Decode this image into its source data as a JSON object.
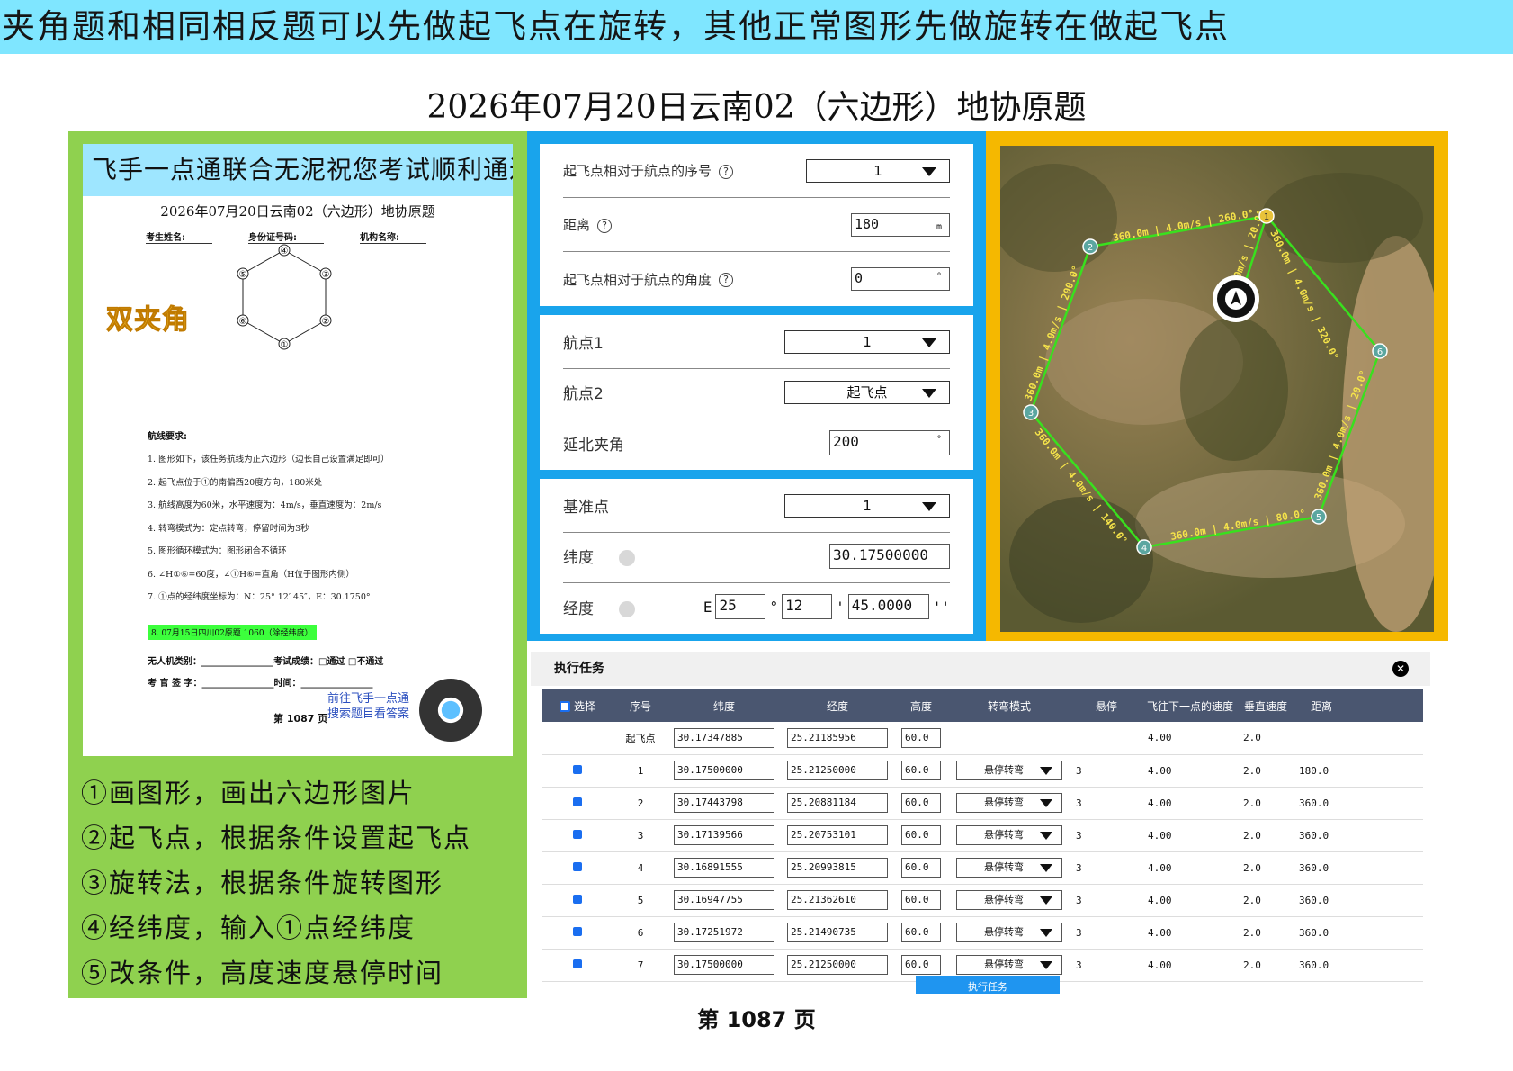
{
  "banner": "夹角题和相同相反题可以先做起飞点在旋转，其他正常图形先做旋转在做起飞点",
  "page_title": "2026年07月20日云南02（六边形）地协原题",
  "footer_page": "第 1087 页",
  "paper": {
    "banner": "飞手一点通联合无泥祝您考试顺利通过",
    "title": "2026年07月20日云南02（六边形）地协原题",
    "field_name": "考生姓名:",
    "field_id": "身份证号码:",
    "field_org": "机构名称:",
    "stamp": "双夹角",
    "hex_labels": [
      "①",
      "②",
      "③",
      "④",
      "⑤",
      "⑥"
    ],
    "req_title": "航线要求:",
    "requirements": [
      "1. 图形如下，该任务航线为正六边形（边长自己设置满足即可）",
      "2. 起飞点位于①的南偏西20度方向，180米处",
      "3. 航线高度为60米，水平速度为：4m/s，垂直速度为：2m/s",
      "4. 转弯模式为：定点转弯，停留时间为3秒",
      "5. 图形循环模式为：图形闭合不循环",
      "6. ∠H①⑥=60度，∠①H⑥=直角（H位于图形内侧）",
      "7. ①点的经纬度坐标为：N：25° 12′ 45″，E：30.1750°"
    ],
    "highlight": "8. 07月15日四川02原题 1060（除经纬度）",
    "sig_line1": "无人机类别：________________考试成绩：□通过  □不通过",
    "sig_line2": "考 官 签 字：________________时间：________________",
    "page": "第 1087 页",
    "go_line1": "前往飞手一点通",
    "go_line2": "搜索题目看答案"
  },
  "steps": [
    "①画图形，画出六边形图片",
    "②起飞点，根据条件设置起飞点",
    "③旋转法，根据条件旋转图形",
    "④经纬度，输入①点经纬度",
    "⑤改条件，高度速度悬停时间"
  ],
  "takeoff_card": {
    "seq_label": "起飞点相对于航点的序号",
    "seq_value": "1",
    "dist_label": "距离",
    "dist_value": "180",
    "dist_unit": "m",
    "angle_label": "起飞点相对于航点的角度",
    "angle_value": "0",
    "angle_unit": "°"
  },
  "angle_card": {
    "wp1_label": "航点1",
    "wp1_value": "1",
    "wp2_label": "航点2",
    "wp2_value": "起飞点",
    "north_label": "延北夹角",
    "north_value": "200",
    "north_unit": "°"
  },
  "ref_card": {
    "ref_label": "基准点",
    "ref_value": "1",
    "lat_label": "纬度",
    "lat_value": "30.17500000",
    "lon_label": "经度",
    "lon_dir": "E",
    "lon_deg": "25",
    "lon_min": "12",
    "lon_sec": "45.0000",
    "deg_sym": "°",
    "min_sym": "'",
    "sec_sym": "''"
  },
  "map": {
    "edge_labels": [
      "360.0m | 4.0m/s | 260.0°",
      "360.0m | 4.0m/s | 320.0°",
      "360.0m | 4.0m/s | 20.0°",
      "360.0m | 4.0m/s | 80.0°",
      "360.0m | 4.0m/s | 140.0°",
      "360.0m | 4.0m/s | 200.0°",
      "4.0m/s | 20.0°"
    ],
    "waypoints": [
      "1",
      "2",
      "3",
      "4",
      "5",
      "6"
    ],
    "path_color": "#39e01e",
    "marker_color": "#e8c23a"
  },
  "task": {
    "title": "执行任务",
    "close": "✕",
    "headers": [
      "选择",
      "序号",
      "纬度",
      "经度",
      "高度",
      "转弯模式",
      "悬停",
      "飞往下一点的速度",
      "垂直速度",
      "距离"
    ],
    "rows": [
      {
        "select": false,
        "seq": "起飞点",
        "lat": "30.17347885",
        "lon": "25.21185956",
        "alt": "60.0",
        "mode": "",
        "hover": "",
        "speed": "4.00",
        "vspeed": "2.0",
        "dist": ""
      },
      {
        "select": true,
        "seq": "1",
        "lat": "30.17500000",
        "lon": "25.21250000",
        "alt": "60.0",
        "mode": "悬停转弯",
        "hover": "3",
        "speed": "4.00",
        "vspeed": "2.0",
        "dist": "180.0"
      },
      {
        "select": true,
        "seq": "2",
        "lat": "30.17443798",
        "lon": "25.20881184",
        "alt": "60.0",
        "mode": "悬停转弯",
        "hover": "3",
        "speed": "4.00",
        "vspeed": "2.0",
        "dist": "360.0"
      },
      {
        "select": true,
        "seq": "3",
        "lat": "30.17139566",
        "lon": "25.20753101",
        "alt": "60.0",
        "mode": "悬停转弯",
        "hover": "3",
        "speed": "4.00",
        "vspeed": "2.0",
        "dist": "360.0"
      },
      {
        "select": true,
        "seq": "4",
        "lat": "30.16891555",
        "lon": "25.20993815",
        "alt": "60.0",
        "mode": "悬停转弯",
        "hover": "3",
        "speed": "4.00",
        "vspeed": "2.0",
        "dist": "360.0"
      },
      {
        "select": true,
        "seq": "5",
        "lat": "30.16947755",
        "lon": "25.21362610",
        "alt": "60.0",
        "mode": "悬停转弯",
        "hover": "3",
        "speed": "4.00",
        "vspeed": "2.0",
        "dist": "360.0"
      },
      {
        "select": true,
        "seq": "6",
        "lat": "30.17251972",
        "lon": "25.21490735",
        "alt": "60.0",
        "mode": "悬停转弯",
        "hover": "3",
        "speed": "4.00",
        "vspeed": "2.0",
        "dist": "360.0"
      },
      {
        "select": true,
        "seq": "7",
        "lat": "30.17500000",
        "lon": "25.21250000",
        "alt": "60.0",
        "mode": "悬停转弯",
        "hover": "3",
        "speed": "4.00",
        "vspeed": "2.0",
        "dist": "360.0"
      }
    ],
    "execute": "执行任务"
  }
}
